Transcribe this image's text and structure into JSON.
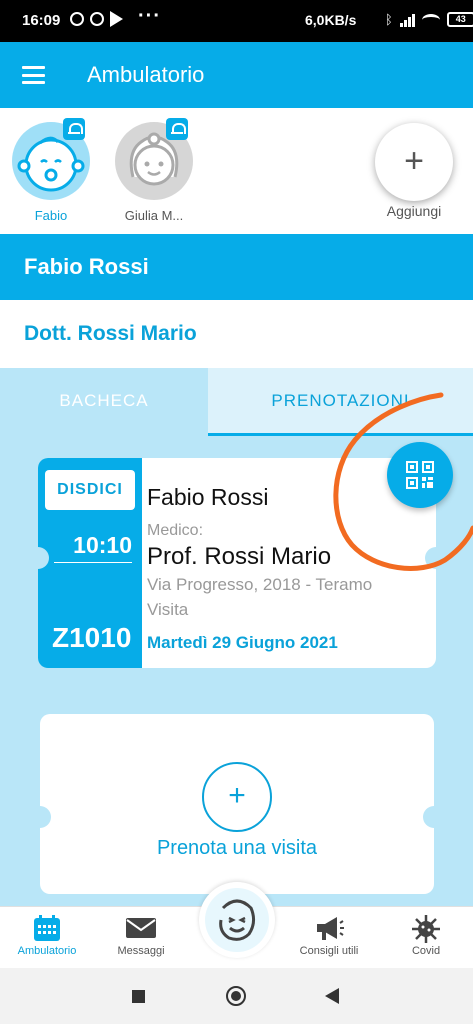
{
  "status_bar": {
    "time": "16:09",
    "more": "···",
    "speed": "6,0KB/s",
    "battery": "43"
  },
  "app_bar": {
    "title": "Ambulatorio"
  },
  "profiles": [
    {
      "name": "Fabio",
      "selected": true
    },
    {
      "name": "Giulia M..."
    }
  ],
  "add_profile": {
    "label": "Aggiungi",
    "symbol": "+"
  },
  "patient": {
    "name": "Fabio Rossi"
  },
  "doctor": {
    "name": "Dott. Rossi Mario"
  },
  "tabs": [
    {
      "label": "BACHECA"
    },
    {
      "label": "PRENOTAZIONI",
      "active": true
    }
  ],
  "booking": {
    "cancel_label": "DISDICI",
    "time": "10:10",
    "code": "Z1010",
    "patient": "Fabio Rossi",
    "doctor_label": "Medico:",
    "doctor": "Prof. Rossi Mario",
    "address": "Via Progresso, 2018 - Teramo",
    "type": "Visita",
    "date": "Martedì 29 Giugno 2021"
  },
  "new_booking": {
    "label": "Prenota una visita",
    "symbol": "+"
  },
  "bottom_nav": [
    {
      "label": "Ambulatorio",
      "icon": "calendar-icon",
      "active": true
    },
    {
      "label": "Messaggi",
      "icon": "mail-icon"
    },
    {
      "label": "",
      "icon": "smiley-icon"
    },
    {
      "label": "Consigli utili",
      "icon": "megaphone-icon"
    },
    {
      "label": "Covid",
      "icon": "virus-icon"
    }
  ],
  "colors": {
    "primary": "#06ace8",
    "text_accent": "#0aa2d9",
    "background": "#b9e6f8",
    "annotation": "#f26b21"
  }
}
